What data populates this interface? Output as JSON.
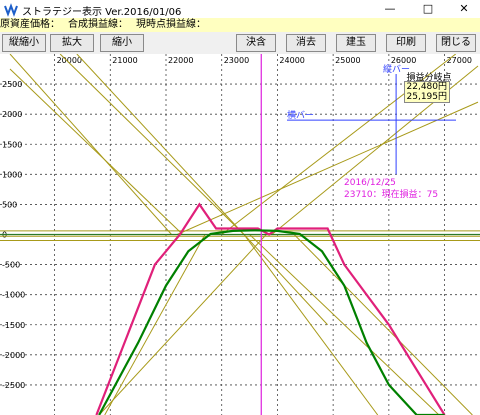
{
  "window": {
    "title": "ストラテジー表示 Ver.2016/01/06",
    "buttons": {
      "minimize": "—",
      "maximize": "□",
      "close": "✕"
    }
  },
  "info_bar": {
    "underlying_price_label": "原資産価格：",
    "combined_pl_label": "合成損益線：",
    "current_pl_label": "現時点損益線："
  },
  "toolbar": {
    "zoom_vertical": "縦縮小",
    "zoom_in": "拡大",
    "zoom_out": "縮小",
    "settle": "決含",
    "clear": "消去",
    "position": "建玉",
    "print": "印刷",
    "close": "閉じる"
  },
  "chart": {
    "x_ticks": [
      "20000",
      "21000",
      "22000",
      "23000",
      "24000",
      "25000",
      "26000",
      "27000"
    ],
    "y_ticks": [
      "2500",
      "2000",
      "1500",
      "1000",
      "500",
      "0",
      "-500",
      "-1000",
      "-1500",
      "-2000",
      "-2500"
    ],
    "vertical_bar_label": "縦バー",
    "horizontal_bar_label": "横バー",
    "breakeven_title": "損益分岐点",
    "breakeven_values": [
      "22,480円",
      "25,195円"
    ],
    "cursor_date": "2016/12/25",
    "cursor_readout": "23710：現在損益：75"
  },
  "chart_data": {
    "type": "line",
    "xlim": [
      19200,
      27600
    ],
    "ylim": [
      -3000,
      3000
    ],
    "x_ticks": [
      20000,
      21000,
      22000,
      23000,
      24000,
      25000,
      26000,
      27000
    ],
    "y_ticks": [
      2500,
      2000,
      1500,
      1000,
      500,
      0,
      -500,
      -1000,
      -1500,
      -2000,
      -2500
    ],
    "grid": true,
    "vertical_marker_x": 23710,
    "current_pl_at_marker": 75,
    "breakeven_points": [
      22480,
      25195
    ],
    "cursor_lines": {
      "x": 26130,
      "y": 1900
    },
    "series": [
      {
        "color": "#e0207a",
        "x": [
          20750,
          21800,
          22250,
          22600,
          22900,
          23650,
          23850,
          24000,
          24100,
          24600,
          24900,
          25200,
          26000,
          27000
        ],
        "y": [
          -3000,
          -500,
          0,
          500,
          100,
          100,
          0,
          100,
          100,
          100,
          100,
          -500,
          -1500,
          -3000
        ]
      },
      {
        "color": "#008000",
        "x": [
          20800,
          21500,
          22000,
          22400,
          22800,
          23200,
          23600,
          24000,
          24400,
          24800,
          25200,
          25600,
          26000,
          26500,
          27000
        ],
        "y": [
          -3000,
          -1800,
          -850,
          -280,
          10,
          60,
          70,
          60,
          10,
          -280,
          -850,
          -1800,
          -2500,
          -3000,
          -3000
        ]
      }
    ],
    "option_legs": [
      {
        "x": [
          19200,
          22100
        ],
        "y": [
          3000,
          0
        ]
      },
      {
        "x": [
          19200,
          22300
        ],
        "y": [
          2750,
          0
        ]
      },
      {
        "x": [
          20100,
          23400
        ],
        "y": [
          3000,
          0
        ]
      },
      {
        "x": [
          20400,
          24900
        ],
        "y": [
          3000,
          -1500
        ]
      },
      {
        "x": [
          20800,
          23800
        ],
        "y": [
          -3000,
          0
        ]
      },
      {
        "x": [
          20900,
          22700
        ],
        "y": [
          -3000,
          0
        ]
      },
      {
        "x": [
          22200,
          27600
        ],
        "y": [
          0,
          2200
        ]
      },
      {
        "x": [
          23000,
          27200
        ],
        "y": [
          0,
          3000
        ]
      },
      {
        "x": [
          23900,
          27600
        ],
        "y": [
          0,
          2800
        ]
      },
      {
        "x": [
          23500,
          26900
        ],
        "y": [
          0,
          -3000
        ]
      },
      {
        "x": [
          24300,
          27500
        ],
        "y": [
          0,
          -3000
        ]
      },
      {
        "x": [
          23400,
          25800
        ],
        "y": [
          0,
          -3000
        ]
      }
    ],
    "horizontal_levels": [
      60,
      -30,
      -100
    ]
  }
}
